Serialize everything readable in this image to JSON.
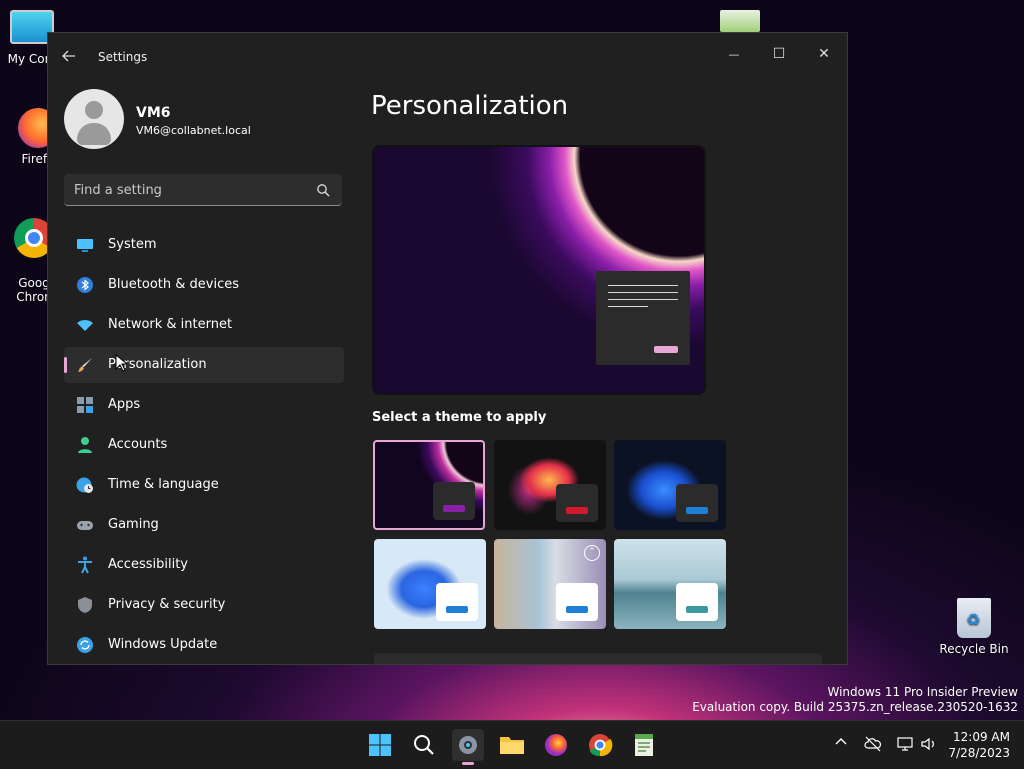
{
  "desktop": {
    "icons": [
      {
        "label": "My Com",
        "icon": "monitor-icon"
      },
      {
        "label": "Firefo",
        "icon": "firefox-icon"
      },
      {
        "label": "Goog\nChron",
        "icon": "chrome-icon"
      },
      {
        "label": "Recycle Bin",
        "icon": "recycle-bin-icon"
      }
    ],
    "watermark": {
      "line1": "Windows 11 Pro Insider Preview",
      "line2": "Evaluation copy. Build 25375.zn_release.230520-1632"
    }
  },
  "window": {
    "title": "Settings",
    "controls": {
      "minimize": "—",
      "maximize": "☐",
      "close": "✕"
    }
  },
  "profile": {
    "name": "VM6",
    "email": "VM6@collabnet.local"
  },
  "search": {
    "placeholder": "Find a setting"
  },
  "sidebar": {
    "items": [
      {
        "label": "System",
        "icon": "system-icon",
        "color": "#4cc2ff"
      },
      {
        "label": "Bluetooth & devices",
        "icon": "bluetooth-icon",
        "color": "#2f7fdc"
      },
      {
        "label": "Network & internet",
        "icon": "wifi-icon",
        "color": "#4cc2ff"
      },
      {
        "label": "Personalization",
        "icon": "brush-icon",
        "color": "#e8a25a",
        "active": true
      },
      {
        "label": "Apps",
        "icon": "apps-icon",
        "color": "#8a9bb0"
      },
      {
        "label": "Accounts",
        "icon": "person-icon",
        "color": "#3ecf8e"
      },
      {
        "label": "Time & language",
        "icon": "globe-clock-icon",
        "color": "#3ba2e8"
      },
      {
        "label": "Gaming",
        "icon": "gamepad-icon",
        "color": "#9aa3ad"
      },
      {
        "label": "Accessibility",
        "icon": "accessibility-icon",
        "color": "#3ba2e8"
      },
      {
        "label": "Privacy & security",
        "icon": "shield-icon",
        "color": "#8a8f98"
      },
      {
        "label": "Windows Update",
        "icon": "update-icon",
        "color": "#3ba2e8"
      }
    ]
  },
  "main": {
    "title": "Personalization",
    "themes_label": "Select a theme to apply",
    "themes": [
      {
        "name": "theme-1",
        "accent": "#8a1fa8",
        "chip": "#2b2b2b",
        "selected": true
      },
      {
        "name": "theme-2",
        "accent": "#d11b2a",
        "chip": "#2b2b2b"
      },
      {
        "name": "theme-3",
        "accent": "#1f7fd6",
        "chip": "#2b2b2b"
      },
      {
        "name": "theme-4",
        "accent": "#1f7fd6",
        "chip": "#ffffff"
      },
      {
        "name": "theme-5",
        "accent": "#1f7fd6",
        "chip": "#ffffff"
      },
      {
        "name": "theme-6",
        "accent": "#3b9aa0",
        "chip": "#ffffff"
      }
    ]
  },
  "taskbar": {
    "items": [
      "start-icon",
      "search-icon",
      "settings-icon",
      "file-explorer-icon",
      "firefox-icon",
      "chrome-icon",
      "notepad-icon"
    ],
    "active": "settings-icon",
    "time": "12:09 AM",
    "date": "7/28/2023"
  },
  "colors": {
    "accent": "#e7a6d6",
    "window_bg": "#202020"
  }
}
